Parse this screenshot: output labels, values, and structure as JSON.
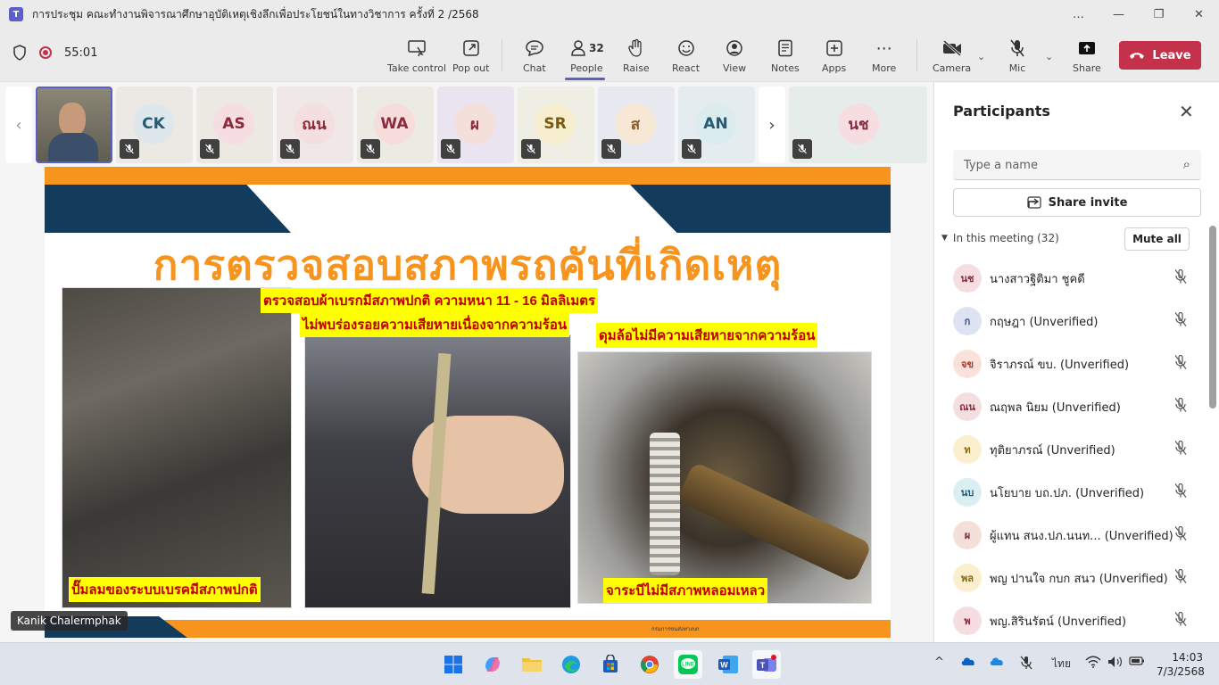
{
  "window": {
    "title": "การประชุม คณะทำงานพิจารณาศึกษาอุบัติเหตุเชิงลึกเพื่อประโยชน์ในทางวิชาการ ครั้งที่ 2 /2568",
    "controls": [
      "…",
      "—",
      "❐",
      "✕"
    ]
  },
  "toolbar": {
    "timer": "55:01",
    "people_count": "32",
    "buttons": {
      "take_control": "Take control",
      "pop_out": "Pop out",
      "chat": "Chat",
      "people": "People",
      "raise": "Raise",
      "react": "React",
      "view": "View",
      "notes": "Notes",
      "apps": "Apps",
      "more": "More",
      "camera": "Camera",
      "mic": "Mic",
      "share": "Share",
      "leave": "Leave"
    }
  },
  "tiles": [
    {
      "initials": "CK",
      "bg": "#ece8e4",
      "av": "#dde7ec",
      "fg": "#245a72"
    },
    {
      "initials": "AS",
      "bg": "#ebe9e2",
      "av": "#f6dde2",
      "fg": "#8a2a3c"
    },
    {
      "initials": "ณน",
      "bg": "#f0e7e7",
      "av": "#f4dfe0",
      "fg": "#8a2a3c"
    },
    {
      "initials": "WA",
      "bg": "#ecebe3",
      "av": "#f7dcdc",
      "fg": "#8a2a3c"
    },
    {
      "initials": "ผ",
      "bg": "#e9e4ef",
      "av": "#f5dfdb",
      "fg": "#8a2a3c"
    },
    {
      "initials": "SR",
      "bg": "#eeeee4",
      "av": "#f7edcf",
      "fg": "#7a5a10"
    },
    {
      "initials": "ส",
      "bg": "#e6eaf0",
      "av": "#f7e8d6",
      "fg": "#8a5a2a"
    },
    {
      "initials": "AN",
      "bg": "#e4ecef",
      "av": "#dbecef",
      "fg": "#245a72"
    },
    {
      "initials": "นช",
      "bg": "#e6ece9",
      "av": "#f6dde2",
      "fg": "#8a2a3c"
    }
  ],
  "slide": {
    "title": "การตรวจสอบสภาพรถคันที่เกิดเหตุ",
    "caption_top1": "ตรวจสอบผ้าเบรกมีสภาพปกติ ความหนา 11 - 16 มิลลิเมตร",
    "caption_top2": "ไม่พบร่องรอยความเสียหายเนื่องจากความร้อน",
    "caption_right": "ดุมล้อไม่มีความเสียหายจากความร้อน",
    "caption_left_bottom": "ปั๊มลมของระบบเบรคมีสภาพปกติ",
    "caption_right_bottom": "จาระบีไม่มีสภาพหลอมเหลว",
    "footer": "กรมการขนส่งทางบก"
  },
  "speaker_name": "Kanik Chalermphak",
  "panel": {
    "title": "Participants",
    "search_placeholder": "Type a name",
    "share_invite": "Share invite",
    "section_label": "In this meeting (32)",
    "mute_all": "Mute all",
    "participants": [
      {
        "initials": "นช",
        "name": "นางสาวฐิติมา ชูคดี",
        "av": "#f6dde2",
        "fg": "#8a2a3c"
      },
      {
        "initials": "ก",
        "name": "กฤษฎา (Unverified)",
        "av": "#dde3f2",
        "fg": "#3a4a8a"
      },
      {
        "initials": "จข",
        "name": "จิราภรณ์ ขบ. (Unverified)",
        "av": "#fbe1dc",
        "fg": "#a33a2a"
      },
      {
        "initials": "ณน",
        "name": "ณฤพล นิยม (Unverified)",
        "av": "#f4dfe0",
        "fg": "#8a2a3c"
      },
      {
        "initials": "ท",
        "name": "ทุติยาภรณ์ (Unverified)",
        "av": "#fbefcf",
        "fg": "#8a6a10"
      },
      {
        "initials": "นบ",
        "name": "นโยบาย บถ.ปภ. (Unverified)",
        "av": "#dbeef2",
        "fg": "#245a72"
      },
      {
        "initials": "ผ",
        "name": "ผู้แทน สนง.ปภ.นนท... (Unverified)",
        "av": "#f5dfdb",
        "fg": "#8a2a3c"
      },
      {
        "initials": "พล",
        "name": "พญ ปานใจ กบก สนว (Unverified)",
        "av": "#fbefcf",
        "fg": "#8a6a10"
      },
      {
        "initials": "พ",
        "name": "พญ.สิรินรัตน์ (Unverified)",
        "av": "#f6dde2",
        "fg": "#8a2a3c"
      }
    ]
  },
  "taskbar": {
    "lang": "ไทย",
    "time": "14:03",
    "date": "7/3/2568"
  },
  "colors": {
    "accent": "#5b5fc7",
    "leave": "#c4314b",
    "slide_orange": "#f7941d",
    "slide_navy": "#123b5c",
    "highlight": "#ffff00",
    "caption_red": "#c00000"
  }
}
